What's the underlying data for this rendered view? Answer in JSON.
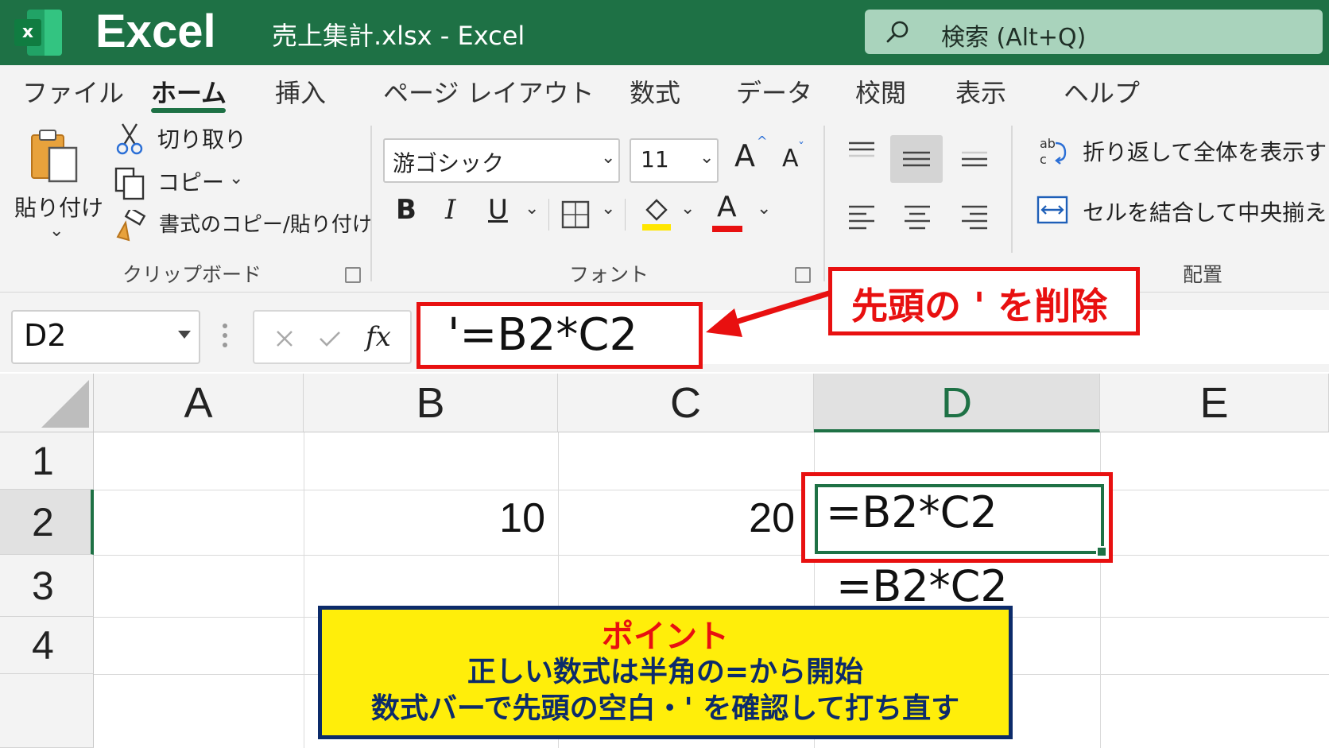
{
  "titlebar": {
    "app_name": "Excel",
    "logo_letter": "x",
    "doc_title": "売上集計.xlsx  -  Excel",
    "search_placeholder": "検索 (Alt+Q)"
  },
  "tabs": [
    {
      "label": "ファイル"
    },
    {
      "label": "ホーム",
      "active": true
    },
    {
      "label": "挿入"
    },
    {
      "label": "ページ レイアウト"
    },
    {
      "label": "数式"
    },
    {
      "label": "データ"
    },
    {
      "label": "校閲"
    },
    {
      "label": "表示"
    },
    {
      "label": "ヘルプ"
    }
  ],
  "ribbon": {
    "clipboard": {
      "paste_label": "貼り付け",
      "cut_label": "切り取り",
      "copy_label": "コピー",
      "format_painter_label": "書式のコピー/貼り付け",
      "group_label": "クリップボード"
    },
    "font": {
      "font_name": "游ゴシック",
      "font_size": "11",
      "bold": "B",
      "italic": "I",
      "underline": "U",
      "font_color_letter": "A",
      "grow_letter": "A",
      "shrink_letter": "A",
      "group_label": "フォント",
      "highlight_color": "#ffe600",
      "font_color": "#e81010"
    },
    "alignment": {
      "wrap_label": "折り返して全体を表示する",
      "merge_label": "セルを結合して中央揃え",
      "group_label": "配置"
    }
  },
  "formula_bar": {
    "name_box": "D2",
    "fx_label": "fx",
    "formula": "'=B2*C2"
  },
  "callout_top": "先頭の ' を削除",
  "grid": {
    "columns": [
      "A",
      "B",
      "C",
      "D",
      "E"
    ],
    "rows": [
      "1",
      "2",
      "3",
      "4"
    ],
    "selected_column": "D",
    "selected_row": "2",
    "b2": "10",
    "c2": "20",
    "d2": "=B2*C2",
    "d3": "=B2*C2"
  },
  "point": {
    "title": "ポイント",
    "line1": "正しい数式は半角の=から開始",
    "line2": "数式バーで先頭の空白・' を確認して打ち直す"
  },
  "colors": {
    "excel_green": "#1e7145",
    "callout_red": "#e81010",
    "point_yellow": "#ffee0a",
    "point_navy": "#0c2b6a"
  }
}
